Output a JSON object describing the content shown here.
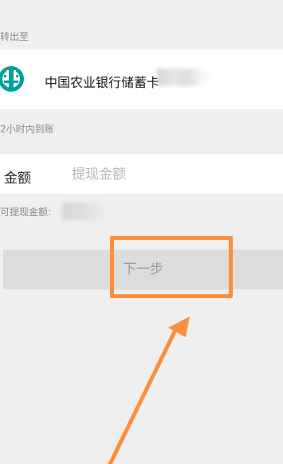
{
  "transfer_to": {
    "label": "转出至"
  },
  "bank_card": {
    "name": "中国农业银行储蓄卡",
    "logo_icon": "abc-bank-logo-icon",
    "logo_color": "#00a29a"
  },
  "arrival": {
    "label": "2小时内到账"
  },
  "amount": {
    "label": "金额",
    "placeholder": "提现金额",
    "value": ""
  },
  "available": {
    "label": "可提现金额:"
  },
  "next_button": {
    "label": "下一步"
  },
  "annotation": {
    "color": "#fb8f3e"
  }
}
